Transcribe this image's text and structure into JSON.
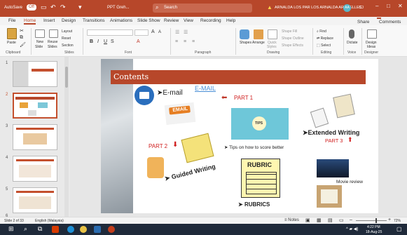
{
  "titlebar": {
    "autosave": "AutoSave",
    "autosave_state": "Off",
    "filename": "PPT Greh...",
    "search": "Search",
    "user": "ARNALDA LOS PAR LOS ARNALDA ARGUELLES.",
    "initials": "AA"
  },
  "tabs": [
    "File",
    "Home",
    "Insert",
    "Design",
    "Transitions",
    "Animations",
    "Slide Show",
    "Review",
    "View",
    "Recording",
    "Help"
  ],
  "share_label": "Share",
  "comments_label": "Comments",
  "ribbon": {
    "clipboard": {
      "paste": "Paste",
      "label": "Clipboard"
    },
    "slides": {
      "new": "New",
      "new2": "Slide",
      "reuse": "Reuse",
      "reuse2": "Slides",
      "layout": "Layout",
      "reset": "Reset",
      "section": "Section",
      "label": "Slides"
    },
    "font": {
      "label": "Font"
    },
    "paragraph": {
      "label": "Paragraph"
    },
    "drawing": {
      "shapes": "Shapes",
      "arrange": "Arrange",
      "quick": "Quick",
      "quick2": "Styles",
      "fill": "Shape Fill",
      "outline": "Shape Outline",
      "effects": "Shape Effects",
      "label": "Drawing"
    },
    "editing": {
      "find": "Find",
      "replace": "Replace",
      "select": "Select",
      "label": "Editing"
    },
    "voice": {
      "dictate": "Dictate",
      "label": "Voice"
    },
    "designer": {
      "design": "Design",
      "ideas": "Ideas",
      "label": "Designer"
    }
  },
  "thumbnails": [
    "1",
    "2",
    "3",
    "4",
    "5",
    "6"
  ],
  "slide": {
    "title": "Contents",
    "email_label": "E-mail",
    "email_hand": "E-MAIL",
    "email_sign": "EMAIL",
    "part1": "PART 1",
    "tips_label": "Tips on how to score better",
    "tips_sign": "TIPS",
    "extended": "Extended Writing",
    "part3": "PART 3",
    "part2": "PART 2",
    "guided": "Guided Writing",
    "rubric_sign": "RUBRIC",
    "rubrics": "RUBRICS",
    "movie": "Movie review"
  },
  "status": {
    "slide": "Slide 2 of 33",
    "language": "English (Malaysia)",
    "notes": "Notes",
    "zoom": "72%"
  },
  "clock": {
    "time": "4:22 PM",
    "date": "18-Aug-25"
  },
  "colors": {
    "accent": "#b7472a",
    "banner": "#b7472a"
  }
}
